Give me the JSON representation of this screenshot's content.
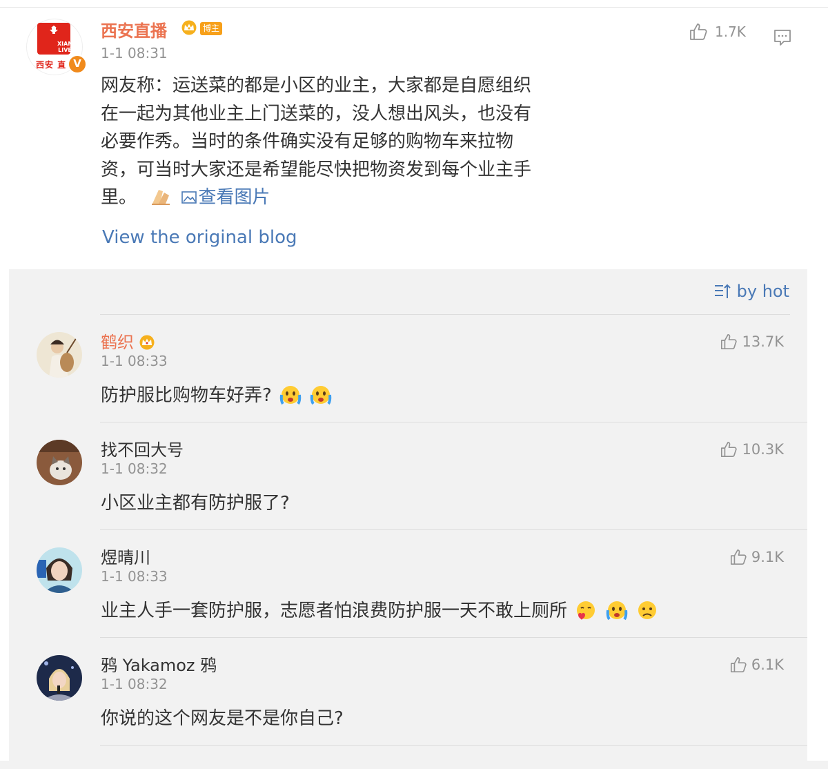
{
  "post": {
    "author": "西安直播",
    "avatar_top_text": "XIAN LIVE",
    "avatar_bottom_text": "西安 直",
    "host_badge": "博主",
    "time": "1-1 08:31",
    "lines": [
      "网友称：运送菜的都是小区的业主，大家都是自愿组织",
      "在一起为其他业主上门送菜的，没人想出风头，也没有",
      "必要作秀。当时的条件确实没有足够的购物车来拉物",
      "资，可当时大家还是希望能尽快把物资发到每个业主手",
      "里。"
    ],
    "view_pics_label": "查看图片",
    "likes": "1.7K",
    "view_original_label": "View the original blog"
  },
  "sort": {
    "label": "by hot"
  },
  "comments": [
    {
      "author": "鹤织",
      "vip": true,
      "time": "1-1 08:33",
      "text": "防护服比购物车好弄?",
      "emojis": [
        "crying-face-icon",
        "crying-face-icon"
      ],
      "likes": "13.7K"
    },
    {
      "author": "找不回大号",
      "vip": false,
      "time": "1-1 08:32",
      "text": "小区业主都有防护服了?",
      "emojis": [],
      "likes": "10.3K"
    },
    {
      "author": "煜晴川",
      "vip": false,
      "time": "1-1 08:33",
      "text": "业主人手一套防护服，志愿者怕浪费防护服一天不敢上厕所",
      "emojis": [
        "heart-face-icon",
        "crying-face-icon",
        "sad-face-icon"
      ],
      "likes": "9.1K"
    },
    {
      "author": "鸦 Yakamoz 鸦",
      "vip": false,
      "time": "1-1 08:32",
      "text": "你说的这个网友是不是你自己?",
      "emojis": [],
      "likes": "6.1K"
    }
  ],
  "colors": {
    "link": "#4a79b6",
    "vip_name": "#eb7350",
    "meta": "#939393",
    "panel": "#f2f2f2"
  }
}
